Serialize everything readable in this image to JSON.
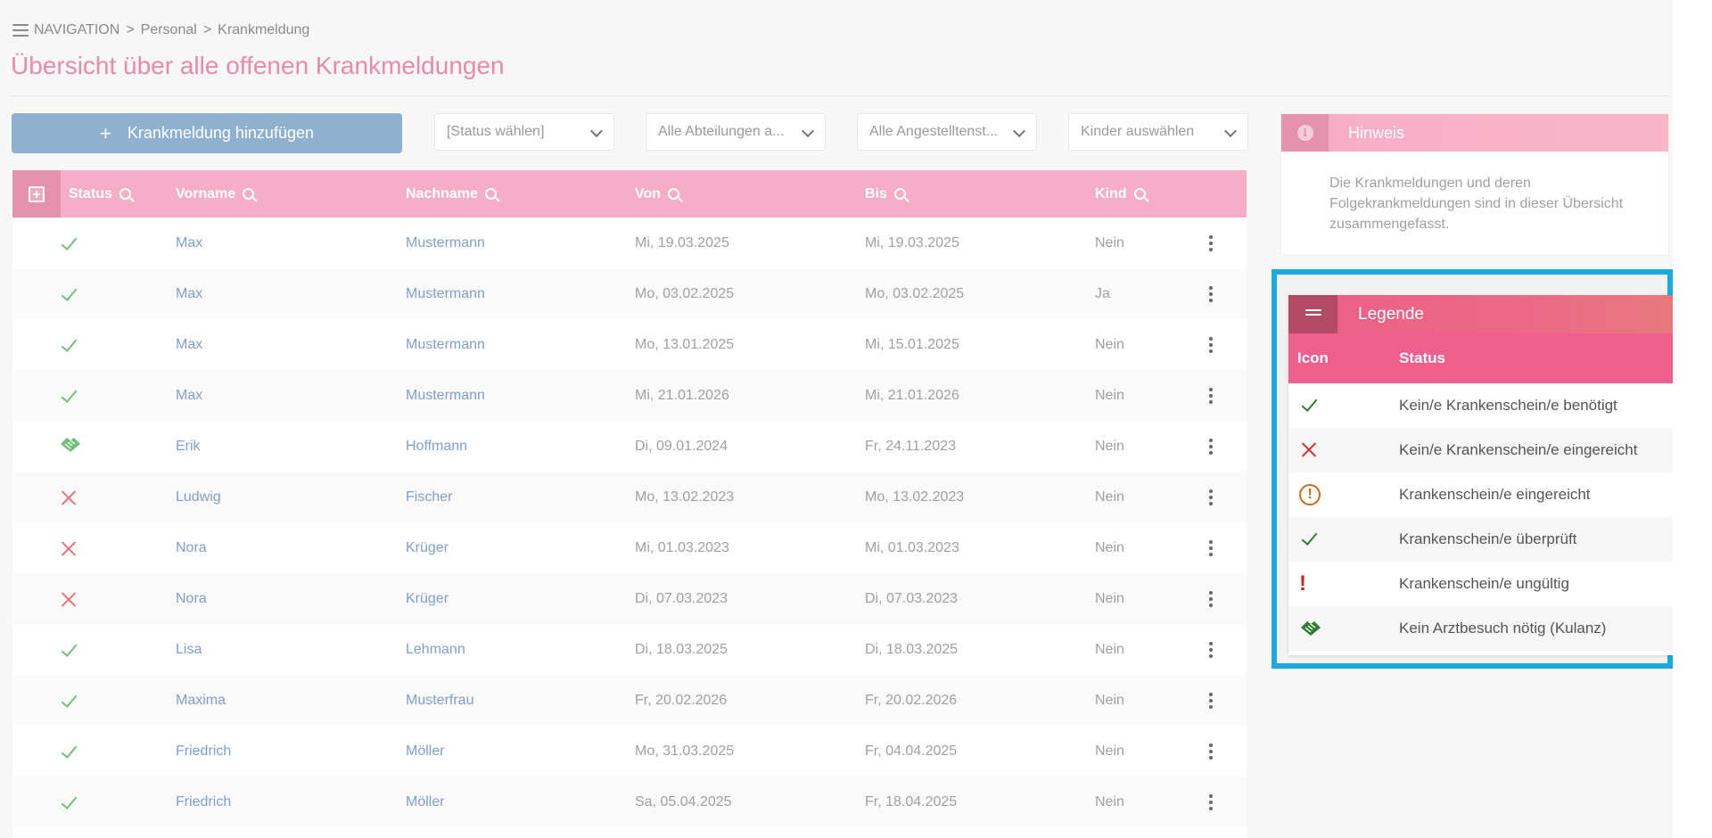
{
  "breadcrumb": {
    "nav_label": "NAVIGATION",
    "sep": ">",
    "level1": "Personal",
    "level2": "Krankmeldung"
  },
  "page_title": "Übersicht über alle offenen Krankmeldungen",
  "toolbar": {
    "add_label": "Krankmeldung hinzufügen",
    "filters": [
      "[Status wählen]",
      "Alle Abteilungen a...",
      "Alle Angestelltenst...",
      "Kinder auswählen"
    ]
  },
  "table": {
    "columns": [
      "Status",
      "Vorname",
      "Nachname",
      "Von",
      "Bis",
      "Kind"
    ],
    "rows": [
      {
        "status": "check",
        "vorname": "Max",
        "nachname": "Mustermann",
        "von": "Mi, 19.03.2025",
        "bis": "Mi, 19.03.2025",
        "kind": "Nein"
      },
      {
        "status": "check",
        "vorname": "Max",
        "nachname": "Mustermann",
        "von": "Mo, 03.02.2025",
        "bis": "Mo, 03.02.2025",
        "kind": "Ja"
      },
      {
        "status": "check",
        "vorname": "Max",
        "nachname": "Mustermann",
        "von": "Mo, 13.01.2025",
        "bis": "Mi, 15.01.2025",
        "kind": "Nein"
      },
      {
        "status": "check",
        "vorname": "Max",
        "nachname": "Mustermann",
        "von": "Mi, 21.01.2026",
        "bis": "Mi, 21.01.2026",
        "kind": "Nein"
      },
      {
        "status": "handshake",
        "vorname": "Erik",
        "nachname": "Hoffmann",
        "von": "Di, 09.01.2024",
        "bis": "Fr, 24.11.2023",
        "kind": "Nein"
      },
      {
        "status": "x",
        "vorname": "Ludwig",
        "nachname": "Fischer",
        "von": "Mo, 13.02.2023",
        "bis": "Mo, 13.02.2023",
        "kind": "Nein"
      },
      {
        "status": "x",
        "vorname": "Nora",
        "nachname": "Krüger",
        "von": "Mi, 01.03.2023",
        "bis": "Mi, 01.03.2023",
        "kind": "Nein"
      },
      {
        "status": "x",
        "vorname": "Nora",
        "nachname": "Krüger",
        "von": "Di, 07.03.2023",
        "bis": "Di, 07.03.2023",
        "kind": "Nein"
      },
      {
        "status": "check",
        "vorname": "Lisa",
        "nachname": "Lehmann",
        "von": "Di, 18.03.2025",
        "bis": "Di, 18.03.2025",
        "kind": "Nein"
      },
      {
        "status": "check",
        "vorname": "Maxima",
        "nachname": "Musterfrau",
        "von": "Fr, 20.02.2026",
        "bis": "Fr, 20.02.2026",
        "kind": "Nein"
      },
      {
        "status": "check",
        "vorname": "Friedrich",
        "nachname": "Möller",
        "von": "Mo, 31.03.2025",
        "bis": "Fr, 04.04.2025",
        "kind": "Nein"
      },
      {
        "status": "check",
        "vorname": "Friedrich",
        "nachname": "Möller",
        "von": "Sa, 05.04.2025",
        "bis": "Fr, 18.04.2025",
        "kind": "Nein"
      }
    ]
  },
  "hint": {
    "title": "Hinweis",
    "icon": "info-icon",
    "text": "Die Krankmeldungen und deren Folgekrankmeldungen sind in dieser Übersicht zusammengefasst."
  },
  "legend": {
    "title": "Legende",
    "col_icon": "Icon",
    "col_status": "Status",
    "items": [
      {
        "icon": "check-dark",
        "label": "Kein/e Krankenschein/e benötigt"
      },
      {
        "icon": "x",
        "label": "Kein/e Krankenschein/e eingereicht"
      },
      {
        "icon": "warning-circle",
        "label": "Krankenschein/e eingereicht"
      },
      {
        "icon": "check-dark",
        "label": "Krankenschein/e überprüft"
      },
      {
        "icon": "exclamation",
        "label": "Krankenschein/e ungültig"
      },
      {
        "icon": "handshake",
        "label": "Kein Arztbesuch nötig (Kulanz)"
      }
    ]
  },
  "colors": {
    "accent_pink": "#f6adc7",
    "title_pink": "#e98aa8",
    "button_blue": "#8fb0cf",
    "check_green": "#6fbf7a",
    "check_dark_green": "#2e7d32",
    "x_red": "#e57373",
    "legend_x_red": "#d32f2f",
    "highlight_blue": "#1ba9e0"
  }
}
